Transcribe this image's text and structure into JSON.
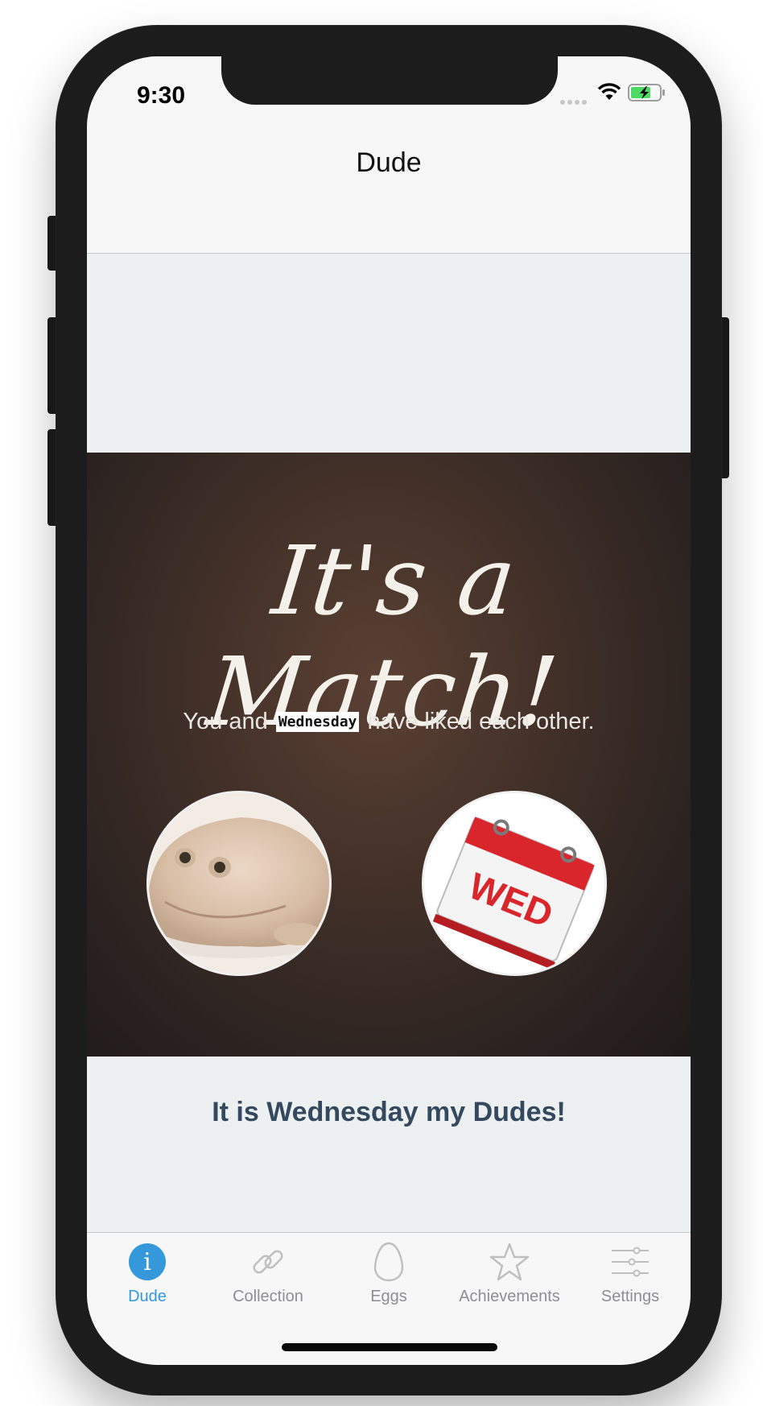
{
  "status_bar": {
    "time": "9:30"
  },
  "nav": {
    "title": "Dude"
  },
  "match_card": {
    "headline": "It's a Match!",
    "sub_before": "You and",
    "sub_name": "Wednesday",
    "sub_after": "have liked each other.",
    "calendar_text": "WED"
  },
  "caption": "It is Wednesday my Dudes!",
  "tabs": [
    {
      "label": "Dude",
      "icon": "info-icon",
      "active": true
    },
    {
      "label": "Collection",
      "icon": "link-icon",
      "active": false
    },
    {
      "label": "Eggs",
      "icon": "egg-icon",
      "active": false
    },
    {
      "label": "Achievements",
      "icon": "star-icon",
      "active": false
    },
    {
      "label": "Settings",
      "icon": "sliders-icon",
      "active": false
    }
  ],
  "colors": {
    "accent": "#3498db",
    "caption": "#34495e",
    "background": "#ecf0f1"
  }
}
